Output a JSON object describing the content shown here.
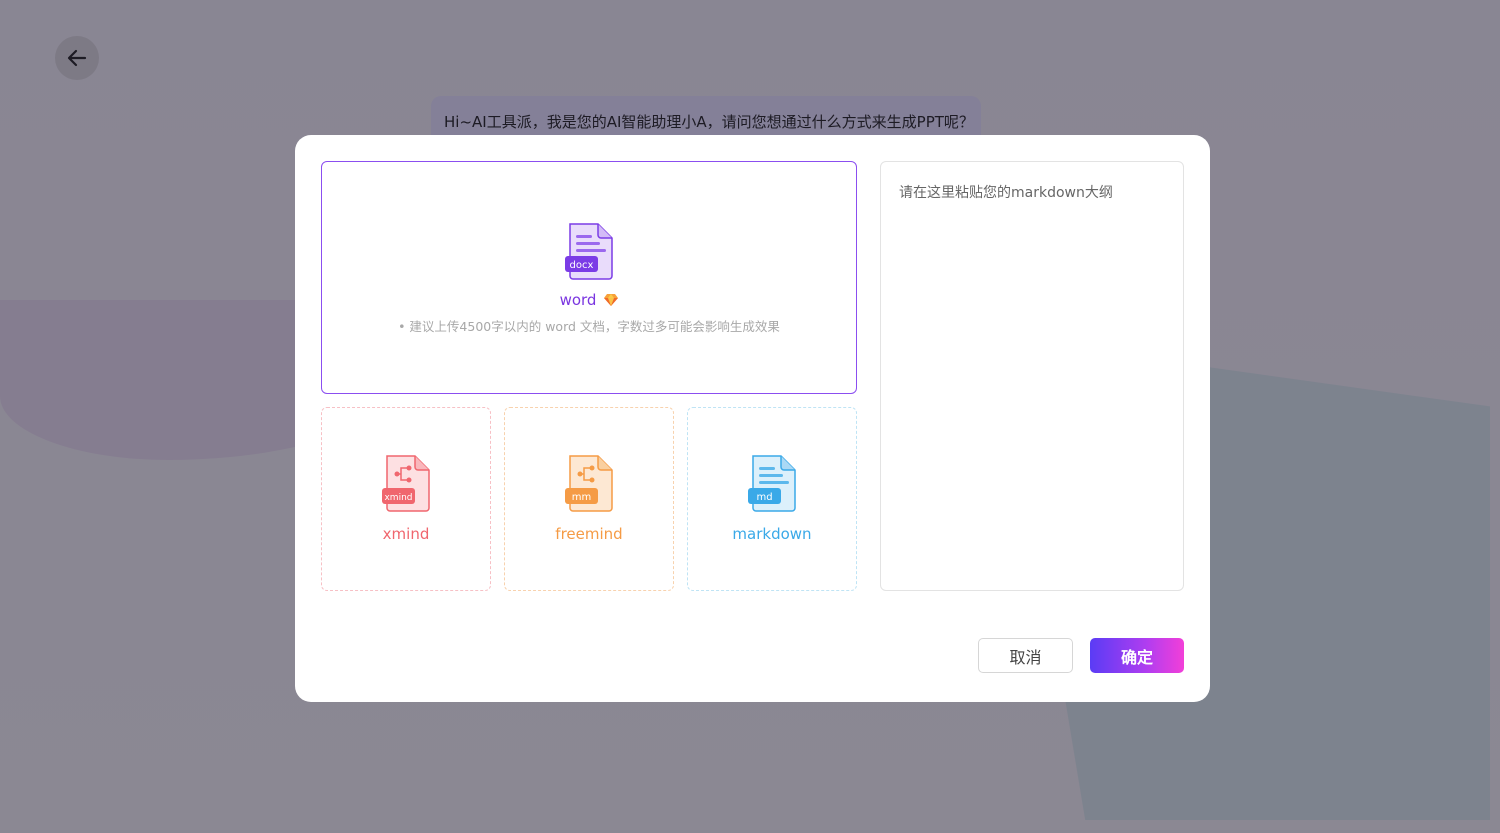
{
  "background": {
    "chat_message": "Hi~AI工具派，我是您的AI智能助理小A，请问您想通过什么方式来生成PPT呢？"
  },
  "modal": {
    "word_card": {
      "badge": "docx",
      "title": "word",
      "hint": "• 建议上传4500字以内的 word 文档，字数过多可能会影响生成效果"
    },
    "xmind_card": {
      "badge": "xmind",
      "title": "xmind",
      "color": "#f0666e"
    },
    "freemind_card": {
      "badge": "mm",
      "title": "freemind",
      "color": "#f59b45"
    },
    "markdown_card": {
      "badge": "md",
      "title": "markdown",
      "color": "#3aa9e8"
    },
    "markdown_input": {
      "placeholder": "请在这里粘贴您的markdown大纲",
      "value": ""
    },
    "cancel_label": "取消",
    "confirm_label": "确定"
  },
  "colors": {
    "accent": "#8b4ef0",
    "confirm_gradient_start": "#5a3cf5",
    "confirm_gradient_end": "#f23fd8"
  },
  "icons": [
    "back-arrow-icon",
    "docx-file-icon",
    "diamond-vip-icon",
    "xmind-file-icon",
    "mm-file-icon",
    "md-file-icon"
  ]
}
